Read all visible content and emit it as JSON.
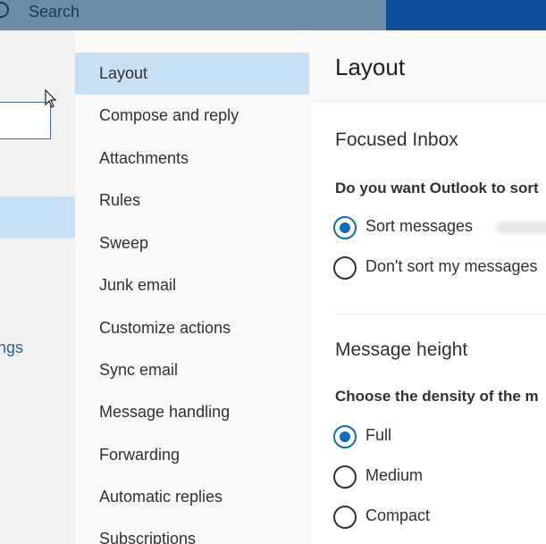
{
  "topbar": {
    "search_label": "Search"
  },
  "left": {
    "partial_label": "ngs"
  },
  "nav": {
    "items": [
      {
        "label": "Layout",
        "active": true
      },
      {
        "label": "Compose and reply"
      },
      {
        "label": "Attachments"
      },
      {
        "label": "Rules"
      },
      {
        "label": "Sweep"
      },
      {
        "label": "Junk email"
      },
      {
        "label": "Customize actions"
      },
      {
        "label": "Sync email"
      },
      {
        "label": "Message handling"
      },
      {
        "label": "Forwarding"
      },
      {
        "label": "Automatic replies"
      },
      {
        "label": "Subscriptions"
      }
    ]
  },
  "content": {
    "title": "Layout",
    "focused": {
      "heading": "Focused Inbox",
      "question": "Do you want Outlook to sort",
      "options": [
        {
          "label": "Sort messages",
          "checked": true
        },
        {
          "label": "Don't sort my messages",
          "checked": false
        }
      ]
    },
    "height": {
      "heading": "Message height",
      "question": "Choose the density of the m",
      "options": [
        {
          "label": "Full",
          "checked": true
        },
        {
          "label": "Medium",
          "checked": false
        },
        {
          "label": "Compact",
          "checked": false
        }
      ]
    }
  },
  "colors": {
    "accent": "#0f6cbd",
    "selected": "#c7e0f4",
    "topbar": "#6d8aa6",
    "brand": "#0f4f99"
  }
}
